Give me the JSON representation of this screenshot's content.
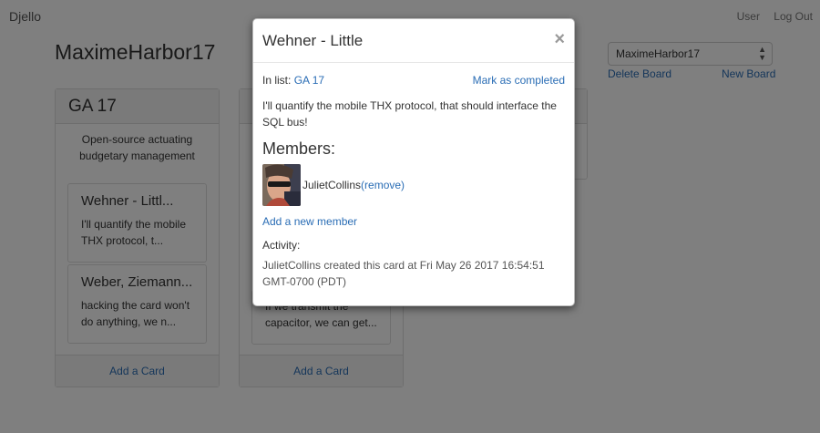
{
  "nav": {
    "brand": "Djello",
    "user": "User",
    "logout": "Log Out"
  },
  "board": {
    "title": "MaximeHarbor17",
    "selector_value": "MaximeHarbor17",
    "delete_label": "Delete Board",
    "new_label": "New Board"
  },
  "lists": [
    {
      "title": "GA 17",
      "description": "Open-source actuating budgetary management",
      "cards": [
        {
          "title": "Wehner - Littl...",
          "text": "I'll quantify the mobile THX protocol, t..."
        },
        {
          "title": "Weber, Ziemann...",
          "text": "hacking the card won't do anything, we n..."
        }
      ],
      "add_card": "Add a Card"
    },
    {
      "card_text": "If we transmit the capacitor, we can get...",
      "add_card": "Add a Card"
    }
  ],
  "modal": {
    "title": "Wehner - Little",
    "close": "×",
    "in_list_label": "In list:",
    "in_list_value": "GA 17",
    "mark_completed": "Mark as completed",
    "description": "I'll quantify the mobile THX protocol, that should interface the SQL bus!",
    "members_heading": "Members:",
    "member_name": "JulietCollins",
    "remove_label": "(remove)",
    "add_member": "Add a new member",
    "activity_heading": "Activity:",
    "activity_text": "JulietCollins created this card at Fri May 26 2017 16:54:51 GMT-0700 (PDT)"
  }
}
